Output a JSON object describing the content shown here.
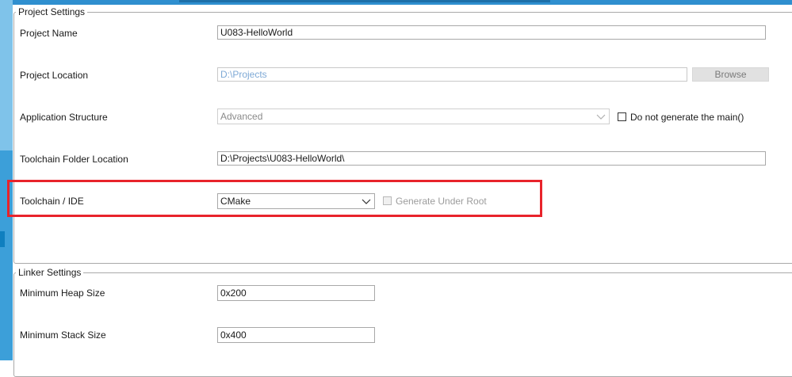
{
  "project_settings": {
    "title": "Project Settings",
    "project_name": {
      "label": "Project Name",
      "value": "U083-HelloWorld"
    },
    "project_location": {
      "label": "Project Location",
      "value": "D:\\Projects",
      "browse_label": "Browse"
    },
    "application_structure": {
      "label": "Application Structure",
      "value": "Advanced",
      "checkbox_label": "Do not generate the main()"
    },
    "toolchain_folder": {
      "label": "Toolchain Folder Location",
      "value": "D:\\Projects\\U083-HelloWorld\\"
    },
    "toolchain_ide": {
      "label": "Toolchain / IDE",
      "value": "CMake",
      "checkbox_label": "Generate Under Root"
    }
  },
  "linker_settings": {
    "title": "Linker Settings",
    "heap": {
      "label": "Minimum Heap Size",
      "value": "0x200"
    },
    "stack": {
      "label": "Minimum Stack Size",
      "value": "0x400"
    }
  },
  "colors": {
    "accent_blue": "#3c9fd9",
    "highlight_red": "#e8232b"
  },
  "icons": {
    "dropdown": "chevron-down-icon"
  }
}
